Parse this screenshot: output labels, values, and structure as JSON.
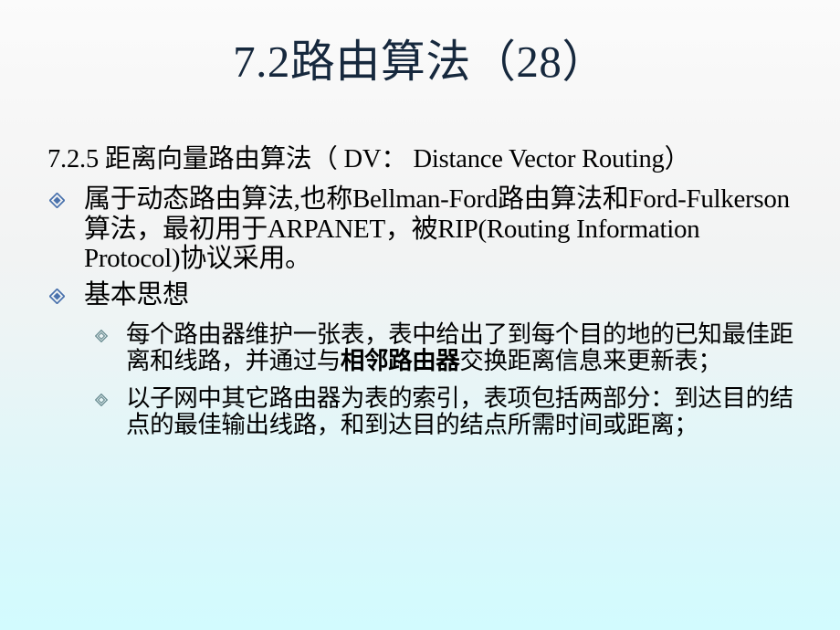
{
  "slide": {
    "title": "7.2路由算法（28）",
    "title_color": "#16283d",
    "background_top_color": "#fbfbfb",
    "background_bottom_color": "#d2fbfe",
    "body_text_color": "#000000",
    "bullet_level1_color": "#4a72ad",
    "bullet_level2_color": "#6d8f94"
  },
  "content": {
    "subhead": "7.2.5  距离向量路由算法（ DV： Distance Vector Routing）",
    "bullets": [
      {
        "level": 1,
        "marker": "diamond-filled-icon",
        "text": "属于动态路由算法,也称Bellman-Ford路由算法和Ford-Fulkerson算法，最初用于ARPANET，被RIP(Routing Information Protocol)协议采用。"
      },
      {
        "level": 1,
        "marker": "diamond-filled-icon",
        "text": "基本思想"
      },
      {
        "level": 2,
        "marker": "diamond-outline-icon",
        "text_part1": "每个路由器维护一张表，表中给出了到每个目的地的已知最佳距离和线路，并通过与",
        "text_bold": "相邻路由器",
        "text_part2": "交换距离信息来更新表；"
      },
      {
        "level": 2,
        "marker": "diamond-outline-icon",
        "text": "以子网中其它路由器为表的索引，表项包括两部分：到达目的结点的最佳输出线路，和到达目的结点所需时间或距离；"
      }
    ]
  }
}
